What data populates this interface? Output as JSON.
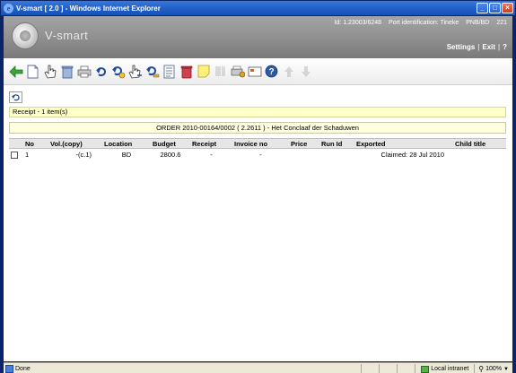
{
  "window": {
    "title": "V-smart [ 2.0 ] - Windows Internet Explorer"
  },
  "header": {
    "brand": "V-smart",
    "id_label": "Id: 1.23003/6248",
    "port_label": "Port identification: Tineke",
    "location_code": "PNB/BD",
    "code": "221",
    "links": [
      "Settings",
      "Exit",
      "?"
    ]
  },
  "toolbar": {
    "icons": [
      "back-arrow-icon",
      "new-document-icon",
      "hand-select-icon",
      "delete-icon",
      "print-icon",
      "undo-arrow-icon",
      "receipt-return-icon",
      "hand-receipt-icon",
      "key-return-icon",
      "list-icon",
      "trash-icon",
      "note-icon",
      "barcode-icon",
      "printer-settings-icon",
      "message-icon",
      "help-icon",
      "arrow-up-icon",
      "arrow-down-icon"
    ],
    "help_glyph": "?"
  },
  "receipt_bar": {
    "text": "Receipt - 1 item(s)"
  },
  "order_bar": {
    "text": "ORDER 2010-00164/0002 ( 2.2611 ) - Het Conclaaf der Schaduwen"
  },
  "table": {
    "columns": [
      "No",
      "Vol.(copy)",
      "Location",
      "Budget",
      "Receipt",
      "Invoice no",
      "Price",
      "Run Id",
      "Exported",
      "Child title"
    ],
    "rows": [
      {
        "no": "1",
        "vol": "-(c.1)",
        "location": "BD",
        "budget": "2800.6",
        "receipt": "-",
        "invoice": "-",
        "price": "",
        "run_id": "",
        "exported": "Claimed: 28 Jul 2010",
        "child_title": ""
      }
    ]
  },
  "statusbar": {
    "status": "Done",
    "zone": "Local intranet",
    "zoom": "100%"
  },
  "colors": {
    "titlebar": "#2160c8",
    "header_gray": "#8c8c8c",
    "yellow_bar": "#ffffc8",
    "table_header": "#e6e6e6"
  }
}
